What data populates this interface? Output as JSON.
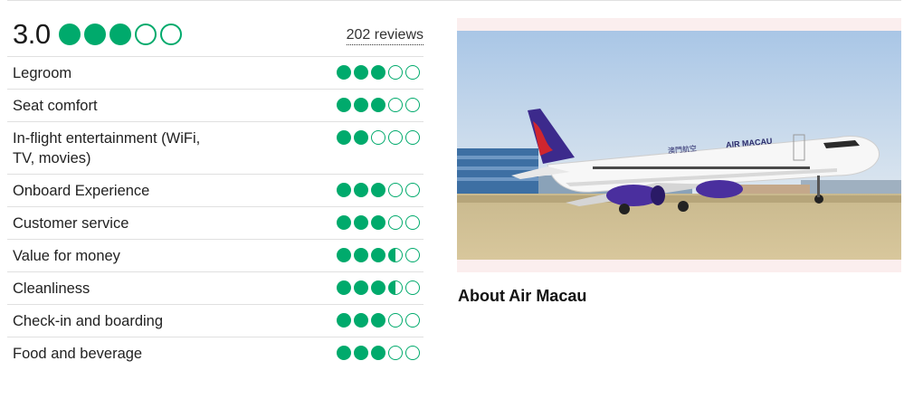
{
  "overall": {
    "score": "3.0",
    "bubbles": 3,
    "reviews_label": "202 reviews"
  },
  "categories": [
    {
      "label": "Legroom",
      "rating": 3
    },
    {
      "label": "Seat comfort",
      "rating": 3
    },
    {
      "label": "In-flight entertainment (WiFi, TV, movies)",
      "rating": 2
    },
    {
      "label": "Onboard Experience",
      "rating": 3
    },
    {
      "label": "Customer service",
      "rating": 3
    },
    {
      "label": "Value for money",
      "rating": 3.5
    },
    {
      "label": "Cleanliness",
      "rating": 3.5
    },
    {
      "label": "Check-in and boarding",
      "rating": 3
    },
    {
      "label": "Food and beverage",
      "rating": 3
    }
  ],
  "photo": {
    "fuselage_text": "AIR MACAU",
    "fuselage_chinese": "澳門航空"
  },
  "about": {
    "title": "About Air Macau"
  },
  "colors": {
    "bubble_green": "#00aa6c",
    "tail_purple": "#3c2a8c",
    "tail_red": "#d0262e"
  }
}
